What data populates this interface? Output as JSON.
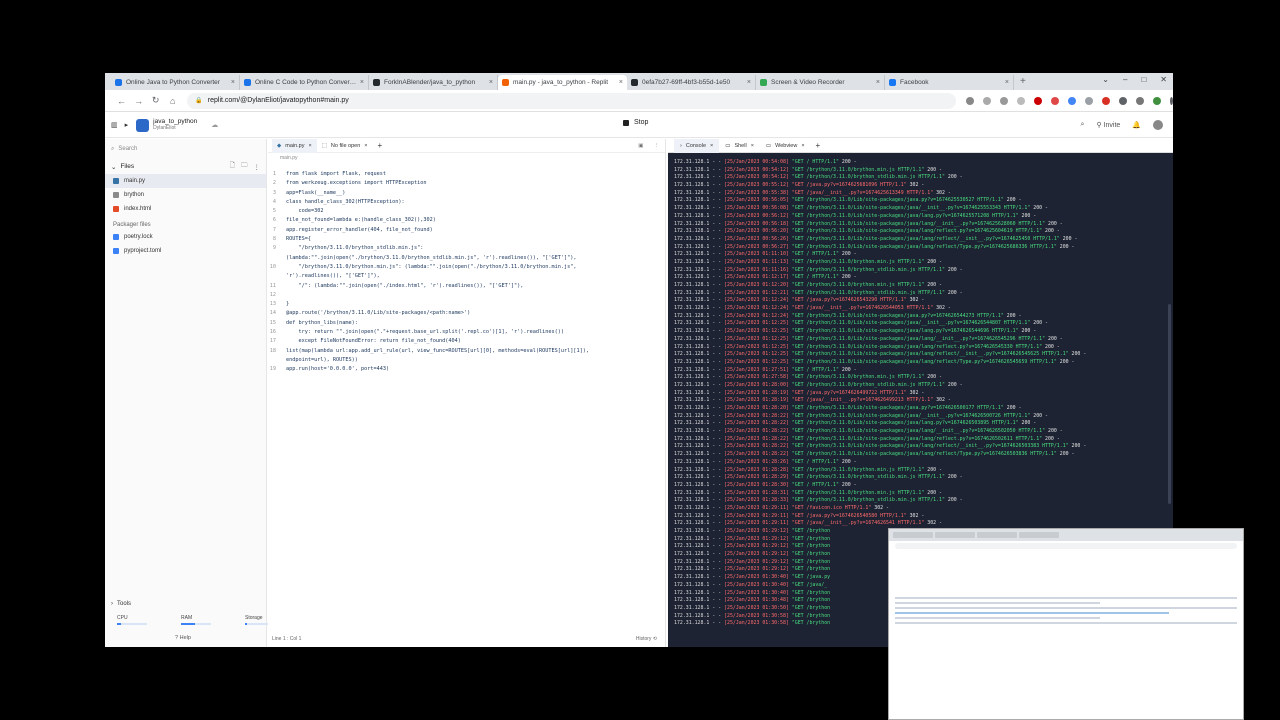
{
  "browser": {
    "tabs": [
      {
        "label": "Online Java to Python Converter",
        "color": "#1a73e8",
        "active": false
      },
      {
        "label": "Online C Code to Python Converter",
        "color": "#1a73e8",
        "active": false
      },
      {
        "label": "ForkInABlender/java_to_python",
        "color": "#24292e",
        "active": false
      },
      {
        "label": "main.py - java_to_python - Replit",
        "color": "#f26207",
        "active": true
      },
      {
        "label": "0efa7b27-69ff-4bf3-b55d-1e50",
        "color": "#24292e",
        "active": false
      },
      {
        "label": "Screen & Video Recorder",
        "color": "#34a853",
        "active": false
      },
      {
        "label": "Facebook",
        "color": "#1877f2",
        "active": false
      }
    ],
    "url": "replit.com/@DylanEliot/javatopython#main.py",
    "new_tab": "+"
  },
  "replit": {
    "repl_name": "java_to_python",
    "repl_owner": "DylanEliot",
    "stop_label": "Stop",
    "invite_label": "Invite",
    "search_placeholder": "Search",
    "files_label": "Files",
    "files": [
      "main.py",
      "brython",
      "index.html"
    ],
    "packager_label": "Packager files",
    "packager_files": [
      "poetry.lock",
      "pyproject.toml"
    ],
    "tools_label": "Tools",
    "meters": [
      {
        "label": "CPU",
        "level": 0.12
      },
      {
        "label": "RAM",
        "level": 0.45
      },
      {
        "label": "Storage",
        "level": 0.08
      }
    ],
    "help_label": "Help"
  },
  "editor": {
    "tab_main": "main.py",
    "tab_nofile": "No file open",
    "breadcrumb": "main.py",
    "status": "Line 1 : Col 1",
    "history": "History",
    "lines": [
      {
        "n": "1",
        "t": "from flask import Flask, request"
      },
      {
        "n": "2",
        "t": "from werkzeug.exceptions import HTTPException"
      },
      {
        "n": "3",
        "t": "app=Flask(__name__)"
      },
      {
        "n": "4",
        "t": "class handle_class_302(HTTPException):"
      },
      {
        "n": "5",
        "t": "    code=302"
      },
      {
        "n": "6",
        "t": "file_not_found=lambda e:(handle_class_302(),302)"
      },
      {
        "n": "7",
        "t": "app.register_error_handler(404, file_not_found)"
      },
      {
        "n": "8",
        "t": "ROUTES={"
      },
      {
        "n": "9",
        "t": "    \"/brython/3.11.0/brython_stdlib.min.js\":"
      },
      {
        "n": "",
        "t": "(lambda:\"\".join(open(\"./brython/3.11.0/brython_stdlib.min.js\", 'r').readlines()), \"['GET']\"),"
      },
      {
        "n": "10",
        "t": "    \"/brython/3.11.0/brython.min.js\": (lambda:\"\".join(open(\"./brython/3.11.0/brython.min.js\","
      },
      {
        "n": "",
        "t": "'r').readlines()), \"['GET']\"),"
      },
      {
        "n": "11",
        "t": "    \"/\": (lambda:\"\".join(open(\"./index.html\", 'r').readlines()), \"['GET']\"),"
      },
      {
        "n": "12",
        "t": ""
      },
      {
        "n": "13",
        "t": "}"
      },
      {
        "n": "14",
        "t": "@app.route('/brython/3.11.0/Lib/site-packages/<path:name>')"
      },
      {
        "n": "15",
        "t": "def brython_libs(name):"
      },
      {
        "n": "16",
        "t": "    try: return \"\".join(open(\".\"+request.base_url.split('.repl.co')[1], 'r').readlines())"
      },
      {
        "n": "17",
        "t": "    except FileNotFoundError: return file_not_found(404)"
      },
      {
        "n": "18",
        "t": "list(map(lambda url:app.add_url_rule(url, view_func=ROUTES[url][0], methods=eval(ROUTES[url][1]),"
      },
      {
        "n": "",
        "t": "endpoint=url), ROUTES))"
      },
      {
        "n": "19",
        "t": "app.run(host='0.0.0.0', port=443)"
      }
    ]
  },
  "console": {
    "tab_console": "Console",
    "tab_shell": "Shell",
    "tab_webview": "Webview",
    "lines": [
      {
        "ip": "172.31.128.1",
        "date": "[25/Jan/2023 00:54:08]",
        "req": "\"GET / HTTP/1.1\"",
        "code": "200 -"
      },
      {
        "ip": "172.31.128.1",
        "date": "[25/Jan/2023 00:54:12]",
        "req": "\"GET /brython/3.11.0/brython.min.js HTTP/1.1\"",
        "code": "200 -"
      },
      {
        "ip": "172.31.128.1",
        "date": "[25/Jan/2023 00:54:12]",
        "req": "\"GET /brython/3.11.0/brython_stdlib.min.js HTTP/1.1\"",
        "code": "200 -"
      },
      {
        "ip": "172.31.128.1",
        "date": "[25/Jan/2023 00:55:12]",
        "req": "\"GET /java.py?v=1674625681096 HTTP/1.1\"",
        "code": "302 -"
      },
      {
        "ip": "172.31.128.1",
        "date": "[25/Jan/2023 00:55:38]",
        "req": "\"GET /java/__init__.py?v=1674625613349 HTTP/1.1\"",
        "code": "302 -"
      },
      {
        "ip": "172.31.128.1",
        "date": "[25/Jan/2023 00:56:05]",
        "req": "\"GET /brython/3.11.0/Lib/site-packages/java.py?v=1674625530527 HTTP/1.1\"",
        "code": "200 -"
      },
      {
        "ip": "172.31.128.1",
        "date": "[25/Jan/2023 00:56:08]",
        "req": "\"GET /brython/3.11.0/Lib/site-packages/java/__init__.py?v=1674625553343 HTTP/1.1\"",
        "code": "200 -"
      },
      {
        "ip": "172.31.128.1",
        "date": "[25/Jan/2023 00:56:12]",
        "req": "\"GET /brython/3.11.0/Lib/site-packages/java/lang.py?v=1674625571208 HTTP/1.1\"",
        "code": "200 -"
      },
      {
        "ip": "172.31.128.1",
        "date": "[25/Jan/2023 00:56:18]",
        "req": "\"GET /brython/3.11.0/Lib/site-packages/java/lang/__init__.py?v=1674625628060 HTTP/1.1\"",
        "code": "200 -"
      },
      {
        "ip": "172.31.128.1",
        "date": "[25/Jan/2023 00:56:20]",
        "req": "\"GET /brython/3.11.0/Lib/site-packages/java/lang/reflect.py?v=1674625604619 HTTP/1.1\"",
        "code": "200 -"
      },
      {
        "ip": "172.31.128.1",
        "date": "[25/Jan/2023 00:56:26]",
        "req": "\"GET /brython/3.11.0/Lib/site-packages/java/lang/reflect/__init__.py?v=1674625450 HTTP/1.1\"",
        "code": "200 -"
      },
      {
        "ip": "172.31.128.1",
        "date": "[25/Jan/2023 00:56:27]",
        "req": "\"GET /brython/3.11.0/Lib/site-packages/java/lang/reflect/Type.py?v=1674625686336 HTTP/1.1\"",
        "code": "200 -"
      },
      {
        "ip": "172.31.128.1",
        "date": "[25/Jan/2023 01:11:10]",
        "req": "\"GET / HTTP/1.1\"",
        "code": "200 -"
      },
      {
        "ip": "172.31.128.1",
        "date": "[25/Jan/2023 01:11:13]",
        "req": "\"GET /brython/3.11.0/brython.min.js HTTP/1.1\"",
        "code": "200 -"
      },
      {
        "ip": "172.31.128.1",
        "date": "[25/Jan/2023 01:11:16]",
        "req": "\"GET /brython/3.11.0/brython_stdlib.min.js HTTP/1.1\"",
        "code": "200 -"
      },
      {
        "ip": "172.31.128.1",
        "date": "[25/Jan/2023 01:12:17]",
        "req": "\"GET / HTTP/1.1\"",
        "code": "200 -"
      },
      {
        "ip": "172.31.128.1",
        "date": "[25/Jan/2023 01:12:20]",
        "req": "\"GET /brython/3.11.0/brython.min.js HTTP/1.1\"",
        "code": "200 -"
      },
      {
        "ip": "172.31.128.1",
        "date": "[25/Jan/2023 01:12:21]",
        "req": "\"GET /brython/3.11.0/brython_stdlib.min.js HTTP/1.1\"",
        "code": "200 -"
      },
      {
        "ip": "172.31.128.1",
        "date": "[25/Jan/2023 01:12:24]",
        "req": "\"GET /java.py?v=1674626543290 HTTP/1.1\"",
        "code": "302 -"
      },
      {
        "ip": "172.31.128.1",
        "date": "[25/Jan/2023 01:12:24]",
        "req": "\"GET /java/__init__.py?v=1674626544053 HTTP/1.1\"",
        "code": "302 -"
      },
      {
        "ip": "172.31.128.1",
        "date": "[25/Jan/2023 01:12:24]",
        "req": "\"GET /brython/3.11.0/Lib/site-packages/java.py?v=1674626544273 HTTP/1.1\"",
        "code": "200 -"
      },
      {
        "ip": "172.31.128.1",
        "date": "[25/Jan/2023 01:12:25]",
        "req": "\"GET /brython/3.11.0/Lib/site-packages/java/__init__.py?v=1674626544807 HTTP/1.1\"",
        "code": "200 -"
      },
      {
        "ip": "172.31.128.1",
        "date": "[25/Jan/2023 01:12:25]",
        "req": "\"GET /brython/3.11.0/Lib/site-packages/java/lang.py?v=1674626544696 HTTP/1.1\"",
        "code": "200 -"
      },
      {
        "ip": "172.31.128.1",
        "date": "[25/Jan/2023 01:12:25]",
        "req": "\"GET /brython/3.11.0/Lib/site-packages/java/lang/__init__.py?v=1674626545296 HTTP/1.1\"",
        "code": "200 -"
      },
      {
        "ip": "172.31.128.1",
        "date": "[25/Jan/2023 01:12:25]",
        "req": "\"GET /brython/3.11.0/Lib/site-packages/java/lang/reflect.py?v=1674626545330 HTTP/1.1\"",
        "code": "200 -"
      },
      {
        "ip": "172.31.128.1",
        "date": "[25/Jan/2023 01:12:25]",
        "req": "\"GET /brython/3.11.0/Lib/site-packages/java/lang/reflect/__init__.py?v=1674626545625 HTTP/1.1\"",
        "code": "200 -"
      },
      {
        "ip": "172.31.128.1",
        "date": "[25/Jan/2023 01:12:25]",
        "req": "\"GET /brython/3.11.0/Lib/site-packages/java/lang/reflect/Type.py?v=1674626545659 HTTP/1.1\"",
        "code": "200 -"
      },
      {
        "ip": "172.31.128.1",
        "date": "[25/Jan/2023 01:27:51]",
        "req": "\"GET / HTTP/1.1\"",
        "code": "200 -"
      },
      {
        "ip": "172.31.128.1",
        "date": "[25/Jan/2023 01:27:58]",
        "req": "\"GET /brython/3.11.0/brython.min.js HTTP/1.1\"",
        "code": "200 -"
      },
      {
        "ip": "172.31.128.1",
        "date": "[25/Jan/2023 01:28:00]",
        "req": "\"GET /brython/3.11.0/brython_stdlib.min.js HTTP/1.1\"",
        "code": "200 -"
      },
      {
        "ip": "172.31.128.1",
        "date": "[25/Jan/2023 01:28:19]",
        "req": "\"GET /java.py?v=1674626499722 HTTP/1.1\"",
        "code": "302 -"
      },
      {
        "ip": "172.31.128.1",
        "date": "[25/Jan/2023 01:28:19]",
        "req": "\"GET /java/__init__.py?v=1674626499213 HTTP/1.1\"",
        "code": "302 -"
      },
      {
        "ip": "172.31.128.1",
        "date": "[25/Jan/2023 01:28:20]",
        "req": "\"GET /brython/3.11.0/Lib/site-packages/java.py?v=1674626500177 HTTP/1.1\"",
        "code": "200 -"
      },
      {
        "ip": "172.31.128.1",
        "date": "[25/Jan/2023 01:28:22]",
        "req": "\"GET /brython/3.11.0/Lib/site-packages/java/__init__.py?v=1674626500726 HTTP/1.1\"",
        "code": "200 -"
      },
      {
        "ip": "172.31.128.1",
        "date": "[25/Jan/2023 01:28:22]",
        "req": "\"GET /brython/3.11.0/Lib/site-packages/java/lang.py?v=1674626503895 HTTP/1.1\"",
        "code": "200 -"
      },
      {
        "ip": "172.31.128.1",
        "date": "[25/Jan/2023 01:28:22]",
        "req": "\"GET /brython/3.11.0/Lib/site-packages/java/lang/__init__.py?v=1674626502050 HTTP/1.1\"",
        "code": "200 -"
      },
      {
        "ip": "172.31.128.1",
        "date": "[25/Jan/2023 01:28:22]",
        "req": "\"GET /brython/3.11.0/Lib/site-packages/java/lang/reflect.py?v=1674626502611 HTTP/1.1\"",
        "code": "200 -"
      },
      {
        "ip": "172.31.128.1",
        "date": "[25/Jan/2023 01:28:22]",
        "req": "\"GET /brython/3.11.0/Lib/site-packages/java/lang/reflect/__init__.py?v=1674626503383 HTTP/1.1\"",
        "code": "200 -"
      },
      {
        "ip": "172.31.128.1",
        "date": "[25/Jan/2023 01:28:22]",
        "req": "\"GET /brython/3.11.0/Lib/site-packages/java/lang/reflect/Type.py?v=1674626503836 HTTP/1.1\"",
        "code": "200 -"
      },
      {
        "ip": "172.31.128.1",
        "date": "[25/Jan/2023 01:28:26]",
        "req": "\"GET / HTTP/1.1\"",
        "code": "200 -"
      },
      {
        "ip": "172.31.128.1",
        "date": "[25/Jan/2023 01:28:28]",
        "req": "\"GET /brython/3.11.0/brython.min.js HTTP/1.1\"",
        "code": "200 -"
      },
      {
        "ip": "172.31.128.1",
        "date": "[25/Jan/2023 01:28:29]",
        "req": "\"GET /brython/3.11.0/brython_stdlib.min.js HTTP/1.1\"",
        "code": "200 -"
      },
      {
        "ip": "172.31.128.1",
        "date": "[25/Jan/2023 01:28:30]",
        "req": "\"GET / HTTP/1.1\"",
        "code": "200 -"
      },
      {
        "ip": "172.31.128.1",
        "date": "[25/Jan/2023 01:28:31]",
        "req": "\"GET /brython/3.11.0/brython.min.js HTTP/1.1\"",
        "code": "200 -"
      },
      {
        "ip": "172.31.128.1",
        "date": "[25/Jan/2023 01:28:33]",
        "req": "\"GET /brython/3.11.0/brython_stdlib.min.js HTTP/1.1\"",
        "code": "200 -"
      },
      {
        "ip": "172.31.128.1",
        "date": "[25/Jan/2023 01:29:11]",
        "req": "\"GET /favicon.ico HTTP/1.1\"",
        "code": "302 -"
      },
      {
        "ip": "172.31.128.1",
        "date": "[25/Jan/2023 01:29:11]",
        "req": "\"GET /java.py?v=1674626540580 HTTP/1.1\"",
        "code": "302 -"
      },
      {
        "ip": "172.31.128.1",
        "date": "[25/Jan/2023 01:29:11]",
        "req": "\"GET /java/__init__.py?v=1674626541 HTTP/1.1\"",
        "code": "302 -"
      },
      {
        "ip": "172.31.128.1",
        "date": "[25/Jan/2023 01:29:12]",
        "req": "\"GET /brython",
        "code": ""
      },
      {
        "ip": "172.31.128.1",
        "date": "[25/Jan/2023 01:29:12]",
        "req": "\"GET /brython",
        "code": ""
      },
      {
        "ip": "172.31.128.1",
        "date": "[25/Jan/2023 01:29:12]",
        "req": "\"GET /brython",
        "code": ""
      },
      {
        "ip": "172.31.128.1",
        "date": "[25/Jan/2023 01:29:12]",
        "req": "\"GET /brython",
        "code": ""
      },
      {
        "ip": "172.31.128.1",
        "date": "[25/Jan/2023 01:29:12]",
        "req": "\"GET /brython",
        "code": ""
      },
      {
        "ip": "172.31.128.1",
        "date": "[25/Jan/2023 01:29:12]",
        "req": "\"GET /brython",
        "code": ""
      },
      {
        "ip": "172.31.128.1",
        "date": "[25/Jan/2023 01:30:40]",
        "req": "\"GET /java.py",
        "code": ""
      },
      {
        "ip": "172.31.128.1",
        "date": "[25/Jan/2023 01:30:40]",
        "req": "\"GET /java/_",
        "code": ""
      },
      {
        "ip": "172.31.128.1",
        "date": "[25/Jan/2023 01:30:40]",
        "req": "\"GET /brython",
        "code": ""
      },
      {
        "ip": "172.31.128.1",
        "date": "[25/Jan/2023 01:30:48]",
        "req": "\"GET /brython",
        "code": ""
      },
      {
        "ip": "172.31.128.1",
        "date": "[25/Jan/2023 01:30:50]",
        "req": "\"GET /brython",
        "code": ""
      },
      {
        "ip": "172.31.128.1",
        "date": "[25/Jan/2023 01:30:58]",
        "req": "\"GET /brython",
        "code": ""
      },
      {
        "ip": "172.31.128.1",
        "date": "[25/Jan/2023 01:30:58]",
        "req": "\"GET /brython",
        "code": ""
      }
    ]
  }
}
